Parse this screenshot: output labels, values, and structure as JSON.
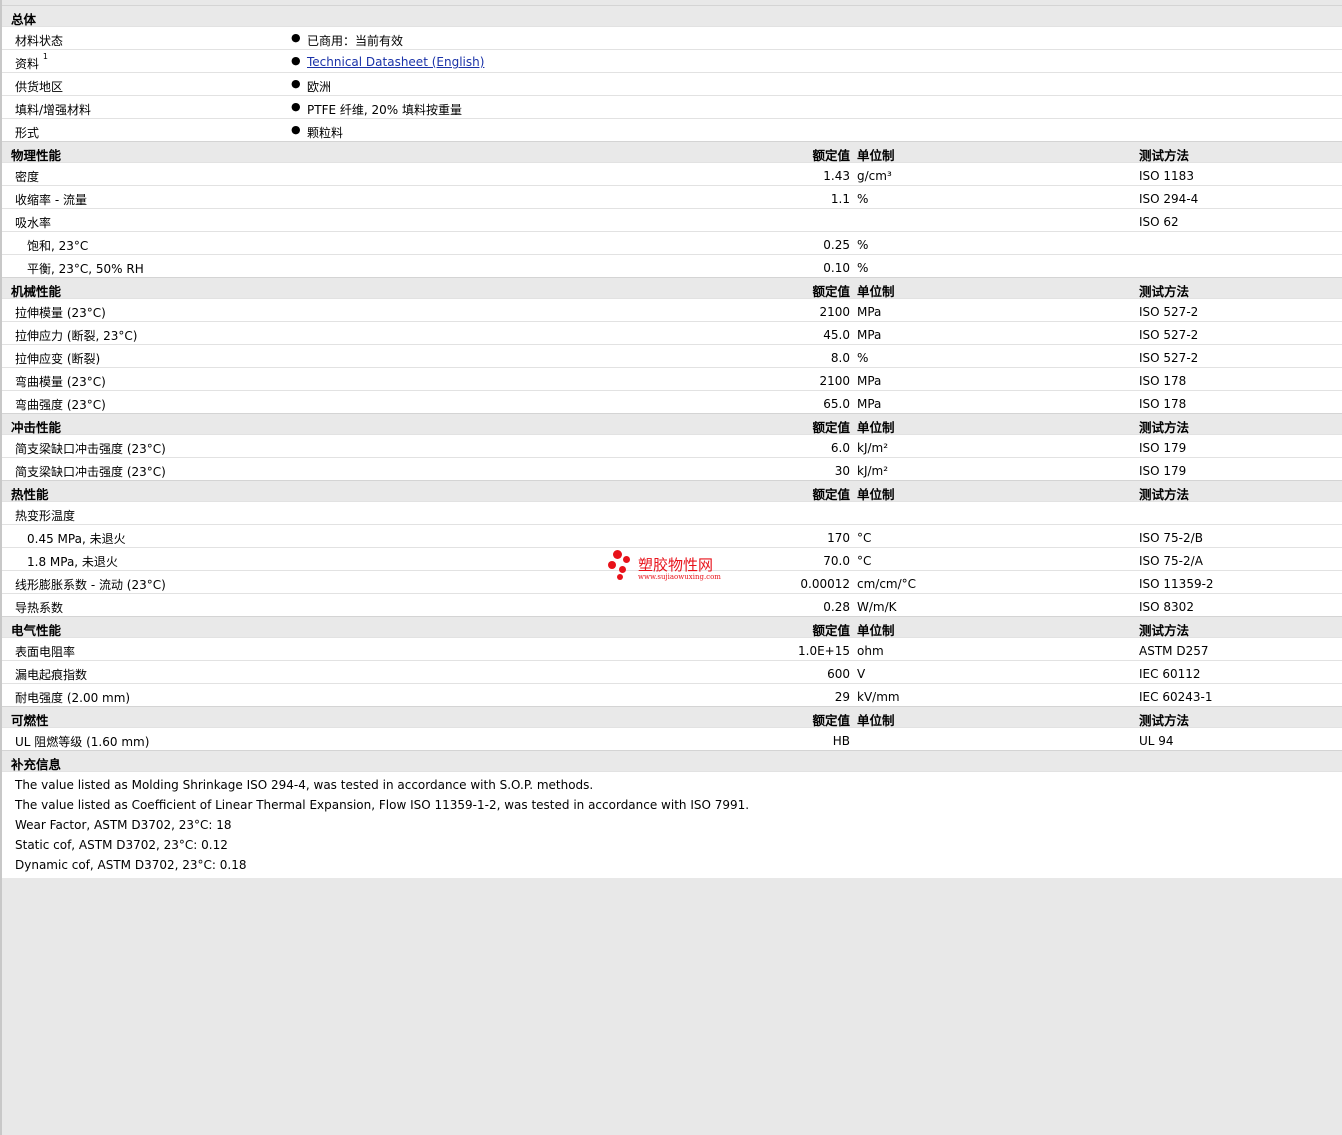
{
  "general": {
    "title": "总体",
    "rows": [
      {
        "label": "材料状态",
        "value": "已商用：当前有效"
      },
      {
        "label": "资料",
        "sup": "1",
        "value": "Technical Datasheet (English)"
      },
      {
        "label": "供货地区",
        "value": "欧洲"
      },
      {
        "label": "填料/增强材料",
        "value": "PTFE 纤维, 20% 填料按重量"
      },
      {
        "label": "形式",
        "value": "颗粒料"
      }
    ]
  },
  "columns": {
    "nominal": "额定值",
    "unit": "单位制",
    "test": "测试方法"
  },
  "sections": [
    {
      "title": "物理性能",
      "rows": [
        {
          "label": "密度",
          "nominal": "1.43",
          "unit": "g/cm³",
          "test": "ISO 1183"
        },
        {
          "label": "收缩率 - 流量",
          "nominal": "1.1",
          "unit": "%",
          "test": "ISO 294-4"
        },
        {
          "label": "吸水率",
          "nominal": "",
          "unit": "",
          "test": "ISO 62"
        },
        {
          "label": "饱和, 23°C",
          "sub": true,
          "nominal": "0.25",
          "unit": "%",
          "test": ""
        },
        {
          "label": "平衡, 23°C, 50% RH",
          "sub": true,
          "nominal": "0.10",
          "unit": "%",
          "test": ""
        }
      ]
    },
    {
      "title": "机械性能",
      "rows": [
        {
          "label": "拉伸模量 (23°C)",
          "nominal": "2100",
          "unit": "MPa",
          "test": "ISO 527-2"
        },
        {
          "label": "拉伸应力 (断裂, 23°C)",
          "nominal": "45.0",
          "unit": "MPa",
          "test": "ISO 527-2"
        },
        {
          "label": "拉伸应变 (断裂)",
          "nominal": "8.0",
          "unit": "%",
          "test": "ISO 527-2"
        },
        {
          "label": "弯曲模量 (23°C)",
          "nominal": "2100",
          "unit": "MPa",
          "test": "ISO 178"
        },
        {
          "label": "弯曲强度 (23°C)",
          "nominal": "65.0",
          "unit": "MPa",
          "test": "ISO 178"
        }
      ]
    },
    {
      "title": "冲击性能",
      "rows": [
        {
          "label": "简支梁缺口冲击强度 (23°C)",
          "nominal": "6.0",
          "unit": "kJ/m²",
          "test": "ISO 179"
        },
        {
          "label": "简支梁缺口冲击强度 (23°C)",
          "nominal": "30",
          "unit": "kJ/m²",
          "test": "ISO 179"
        }
      ]
    },
    {
      "title": "热性能",
      "rows": [
        {
          "label": "热变形温度",
          "nominal": "",
          "unit": "",
          "test": ""
        },
        {
          "label": "0.45 MPa, 未退火",
          "sub": true,
          "nominal": "170",
          "unit": "°C",
          "test": "ISO 75-2/B"
        },
        {
          "label": "1.8 MPa, 未退火",
          "sub": true,
          "nominal": "70.0",
          "unit": "°C",
          "test": "ISO 75-2/A"
        },
        {
          "label": "线形膨胀系数 - 流动 (23°C)",
          "nominal": "0.00012",
          "unit": "cm/cm/°C",
          "test": "ISO 11359-2"
        },
        {
          "label": "导热系数",
          "nominal": "0.28",
          "unit": "W/m/K",
          "test": "ISO 8302"
        }
      ]
    },
    {
      "title": "电气性能",
      "rows": [
        {
          "label": "表面电阻率",
          "nominal": "1.0E+15",
          "unit": "ohm",
          "test": "ASTM D257"
        },
        {
          "label": "漏电起痕指数",
          "nominal": "600",
          "unit": "V",
          "test": "IEC 60112"
        },
        {
          "label": "耐电强度 (2.00 mm)",
          "nominal": "29",
          "unit": "kV/mm",
          "test": "IEC 60243-1"
        }
      ]
    },
    {
      "title": "可燃性",
      "rows": [
        {
          "label": "UL 阻燃等级 (1.60 mm)",
          "nominal": "HB",
          "unit": "",
          "test": "UL 94"
        }
      ]
    }
  ],
  "notes": {
    "title": "补充信息",
    "items": [
      "The value listed as Molding Shrinkage ISO 294-4, was tested in accordance with S.O.P. methods.",
      "The value listed as Coefficient of Linear Thermal Expansion, Flow ISO 11359-1-2, was tested in accordance with ISO 7991.",
      "Wear Factor, ASTM D3702, 23°C: 18",
      "Static cof, ASTM D3702, 23°C: 0.12",
      "Dynamic cof, ASTM D3702, 23°C: 0.18"
    ]
  },
  "watermark": {
    "name": "塑胶物性网",
    "url": "www.sujiaowuxing.com",
    "color": "#e8121a"
  }
}
